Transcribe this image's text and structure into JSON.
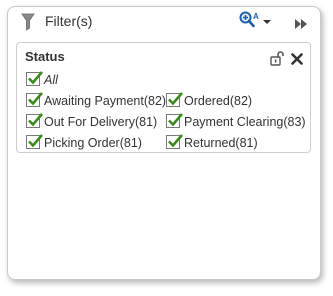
{
  "header": {
    "title": "Filter(s)",
    "zoom_letter": "A",
    "icons": [
      "filter-icon",
      "zoom-icon",
      "collapse-icon"
    ]
  },
  "facet": {
    "title": "Status",
    "icons": [
      "unlock-icon",
      "close-icon"
    ],
    "all_label": "All",
    "options": [
      {
        "label": "Awaiting Payment(82)",
        "checked": true
      },
      {
        "label": "Ordered(82)",
        "checked": true
      },
      {
        "label": "Out For Delivery(81)",
        "checked": true
      },
      {
        "label": "Payment Clearing(83)",
        "checked": true
      },
      {
        "label": "Picking Order(81)",
        "checked": true
      },
      {
        "label": "Returned(81)",
        "checked": true
      }
    ]
  },
  "colors": {
    "check": "#3a8a1c",
    "zoom": "#1f5faa",
    "icon_gray": "#555555"
  }
}
